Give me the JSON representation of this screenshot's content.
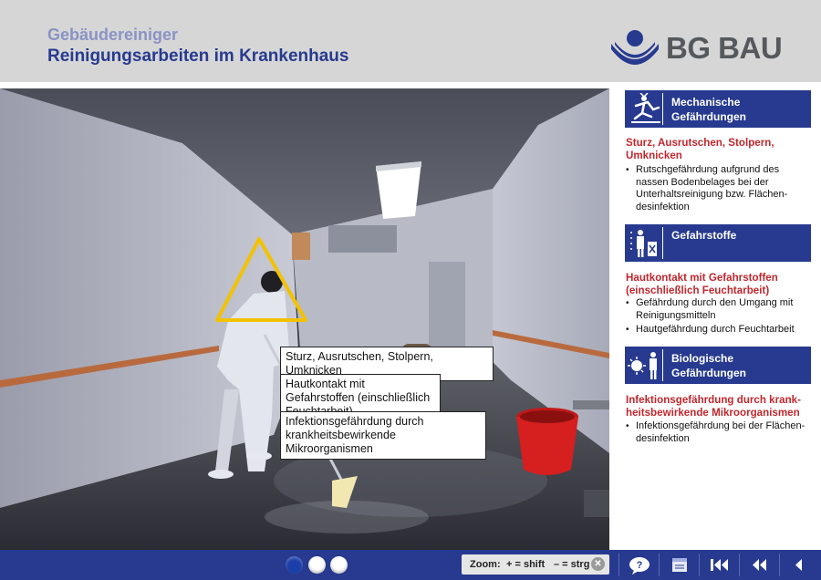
{
  "header": {
    "subtitle": "Gebäudereiniger",
    "title": "Reinigungsarbeiten im Krankenhaus",
    "logo_text": "BG BAU"
  },
  "callouts": [
    "Sturz, Ausrutschen, Stolpern, Umknicken",
    "Hautkontakt mit Gefahrstoffen (einschließlich Feuchtarbeit)",
    "Infektionsgefährdung durch krankheitsbewirkende Mikroorganismen"
  ],
  "sidebar": {
    "categories": [
      {
        "label": "Mechanische Gefährdungen",
        "icon": "slip-hazard-icon",
        "hazard_title": "Sturz, Ausrutschen, Stolpern, Umknicken",
        "items": [
          "Rutschgefährdung aufgrund des nassen Bodenbelages bei der Unterhaltsreinigung bzw. Flächen-desinfektion"
        ]
      },
      {
        "label": "Gefahrstoffe",
        "icon": "hazardous-substances-icon",
        "hazard_title": "Hautkontakt mit Gefahrstoffen (einschließlich Feuchtarbeit)",
        "items": [
          "Gefährdung durch den Umgang mit Reinigungsmitteln",
          "Hautgefährdung durch Feuchtarbeit"
        ]
      },
      {
        "label": "Biologische Gefährdungen",
        "icon": "biohazard-icon",
        "hazard_title": "Infektionsgefährdung durch krank-heitsbewirkende Mikroorganismen",
        "items": [
          "Infektionsgefährdung bei der Flächen-desinfektion"
        ]
      }
    ]
  },
  "footer": {
    "zoom_label": "Zoom:",
    "zoom_plus": "+ = shift",
    "zoom_minus": "– = strg",
    "close_symbol": "✕",
    "page_dots": 3,
    "active_dot": 0,
    "buttons": [
      "help-icon",
      "notes-icon",
      "first-page-icon",
      "rewind-icon",
      "back-icon"
    ]
  },
  "colors": {
    "brand_blue": "#273a8f",
    "accent_red": "#c0272d",
    "header_gray": "#d6d6d6",
    "warning_yellow": "#f2c200"
  }
}
